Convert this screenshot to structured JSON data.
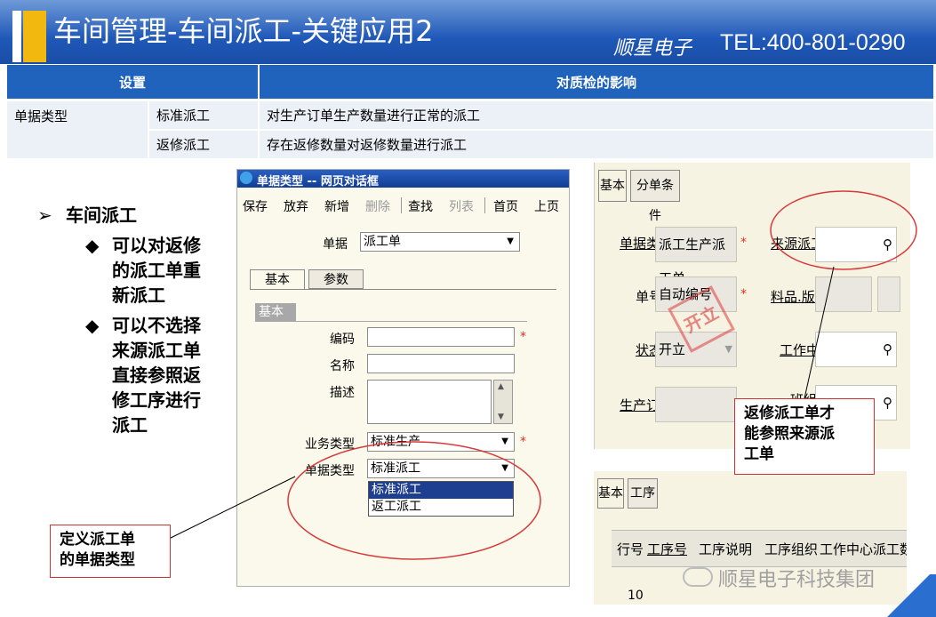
{
  "header": {
    "title": "车间管理-车间派工-关键应用2",
    "brand": "顺星电子",
    "tel": "TEL:400-801-0290"
  },
  "table": {
    "headers": [
      "设置",
      "对质检的影响"
    ],
    "group_label": "单据类型",
    "rows": [
      {
        "type": "标准派工",
        "effect": "对生产订单生产数量进行正常的派工"
      },
      {
        "type": "返修派工",
        "effect": "存在返修数量对返修数量进行派工"
      }
    ]
  },
  "left_text": {
    "heading": "车间派工",
    "bullets": [
      [
        "可以对返修",
        "的派工单重",
        "新派工"
      ],
      [
        "可以不选择",
        "来源派工单",
        "直接参照返",
        "修工序进行",
        "派工"
      ]
    ]
  },
  "dialog": {
    "title": "单据类型  --  网页对话框",
    "toolbar": {
      "save": "保存",
      "discard": "放弃",
      "new": "新增",
      "delete": "删除",
      "find": "查找",
      "list": "列表",
      "first": "首页",
      "prev": "上页"
    },
    "doc_label": "单据",
    "doc_value": "派工单",
    "tabs": [
      "基本",
      "参数"
    ],
    "section": "基本",
    "fields": {
      "code_label": "编码",
      "name_label": "名称",
      "desc_label": "描述",
      "biz_type_label": "业务类型",
      "biz_type_value": "标准生产",
      "doc_type_label": "单据类型",
      "doc_type_value": "标准派工"
    },
    "dropdown_options": [
      "标准派工",
      "返工派工"
    ],
    "required_mark": "*"
  },
  "callout_left": {
    "lines": [
      "定义派工单",
      "的单据类型"
    ]
  },
  "right_panel": {
    "tabs": [
      "基本",
      "分单条件"
    ],
    "labels": {
      "doc_type": "单据类型",
      "source": "来源派工单",
      "number": "单号",
      "material": "料品.版本",
      "status": "状态",
      "work_center": "工作中心",
      "prod_order": "生产订单",
      "shift": "班组"
    },
    "values": {
      "doc_type": "派工生产派工单",
      "number": "自动编号",
      "status": "开立"
    },
    "stamp": "开立"
  },
  "callout_right": {
    "lines": [
      "返修派工单才",
      "能参照来源派",
      "工单"
    ]
  },
  "grid_panel": {
    "tabs": [
      "基本",
      "工序"
    ],
    "columns": [
      "行号",
      "工序号",
      "工序说明",
      "工序组织",
      "工作中心",
      "派工数量"
    ],
    "first_row": "10"
  },
  "watermark": "顺星电子科技集团",
  "colors": {
    "title_bg": "#1f58b8",
    "accent": "#f2b80f",
    "table_head": "#1f63bd",
    "highlight": "#1e3f8f",
    "circle": "#d83a3a"
  }
}
